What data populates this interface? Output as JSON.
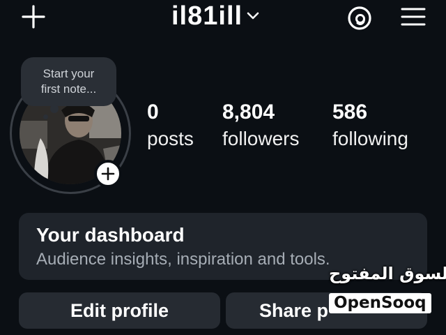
{
  "header": {
    "username": "il81ill",
    "icons": {
      "create": "plus-icon",
      "switch": "chevron-down-icon",
      "threads": "threads-icon",
      "menu": "hamburger-menu-icon"
    }
  },
  "profile": {
    "note_line1": "Start your",
    "note_line2": "first note...",
    "avatar_alt": "profile-photo",
    "add_story_icon": "plus-icon"
  },
  "stats": [
    {
      "value": "0",
      "label": "posts"
    },
    {
      "value": "8,804",
      "label": "followers"
    },
    {
      "value": "586",
      "label": "following"
    }
  ],
  "dashboard": {
    "title": "Your dashboard",
    "subtitle": "Audience insights, inspiration and tools."
  },
  "actions": {
    "edit_profile": "Edit profile",
    "share_profile": "Share p"
  },
  "watermark": {
    "arabic": "السوق المفتوح",
    "latin": "OpenSooq"
  },
  "colors": {
    "background": "#0b0f14",
    "card": "#1f242b",
    "button": "#262b32",
    "text": "#ffffff",
    "muted": "#a6adb5"
  }
}
